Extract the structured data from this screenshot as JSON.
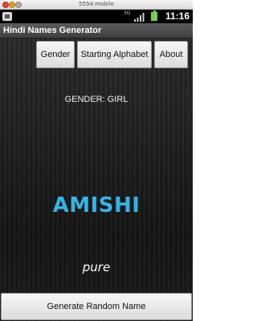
{
  "emulator": {
    "title": "5554:mobile"
  },
  "status_bar": {
    "network": "3G",
    "time": "11:16",
    "icons": [
      "notification-icon",
      "signal-icon",
      "battery-charging-icon"
    ]
  },
  "app": {
    "title": "Hindi Names Generator"
  },
  "menu": {
    "gender_label": "Gender",
    "starting_alphabet_label": "Starting Alphabet",
    "about_label": "About"
  },
  "result": {
    "gender_text": "GENDER: GIRL",
    "name": "AMISHI",
    "meaning": "pure",
    "name_color": "#33b5e5"
  },
  "actions": {
    "generate_label": "Generate Random Name"
  }
}
